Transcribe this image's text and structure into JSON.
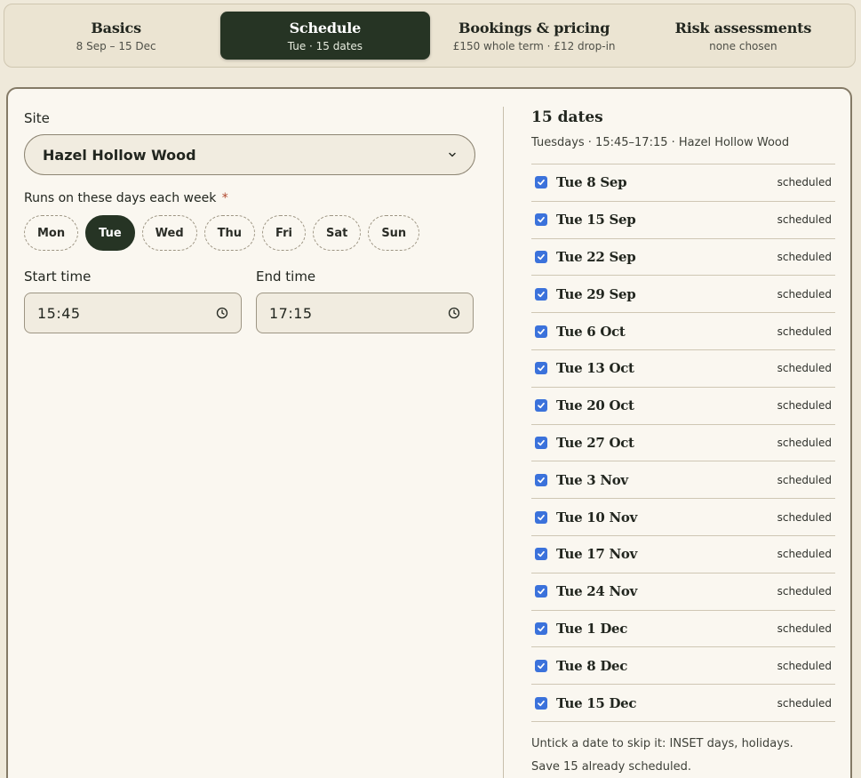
{
  "tabs": [
    {
      "title": "Basics",
      "sub": "8 Sep – 15 Dec"
    },
    {
      "title": "Schedule",
      "sub": "Tue · 15 dates"
    },
    {
      "title": "Bookings & pricing",
      "sub": "£150 whole term · £12 drop-in"
    },
    {
      "title": "Risk assessments",
      "sub": "none chosen"
    }
  ],
  "site": {
    "label": "Site",
    "value": "Hazel Hollow Wood"
  },
  "days": {
    "label": "Runs on these days each week",
    "required_mark": "*",
    "items": [
      "Mon",
      "Tue",
      "Wed",
      "Thu",
      "Fri",
      "Sat",
      "Sun"
    ],
    "selected": "Tue"
  },
  "start_time": {
    "label": "Start time",
    "value": "15:45"
  },
  "end_time": {
    "label": "End time",
    "value": "17:15"
  },
  "dates": {
    "title": "15 dates",
    "subtitle": "Tuesdays · 15:45–17:15 · Hazel Hollow Wood",
    "items": [
      {
        "date": "Tue 8 Sep",
        "status": "scheduled"
      },
      {
        "date": "Tue 15 Sep",
        "status": "scheduled"
      },
      {
        "date": "Tue 22 Sep",
        "status": "scheduled"
      },
      {
        "date": "Tue 29 Sep",
        "status": "scheduled"
      },
      {
        "date": "Tue 6 Oct",
        "status": "scheduled"
      },
      {
        "date": "Tue 13 Oct",
        "status": "scheduled"
      },
      {
        "date": "Tue 20 Oct",
        "status": "scheduled"
      },
      {
        "date": "Tue 27 Oct",
        "status": "scheduled"
      },
      {
        "date": "Tue 3 Nov",
        "status": "scheduled"
      },
      {
        "date": "Tue 10 Nov",
        "status": "scheduled"
      },
      {
        "date": "Tue 17 Nov",
        "status": "scheduled"
      },
      {
        "date": "Tue 24 Nov",
        "status": "scheduled"
      },
      {
        "date": "Tue 1 Dec",
        "status": "scheduled"
      },
      {
        "date": "Tue 8 Dec",
        "status": "scheduled"
      },
      {
        "date": "Tue 15 Dec",
        "status": "scheduled"
      }
    ],
    "hint_line1": "Untick a date to skip it: INSET days, holidays.",
    "hint_line2": "Save 15 already scheduled."
  },
  "icons": {
    "select": "chevron-down-icon",
    "time": "clock-icon",
    "check": "checkbox-checked-icon"
  },
  "colors": {
    "accent": "#263424",
    "checkbox": "#3b72db",
    "required": "#b0472c",
    "background": "#efe9da"
  }
}
